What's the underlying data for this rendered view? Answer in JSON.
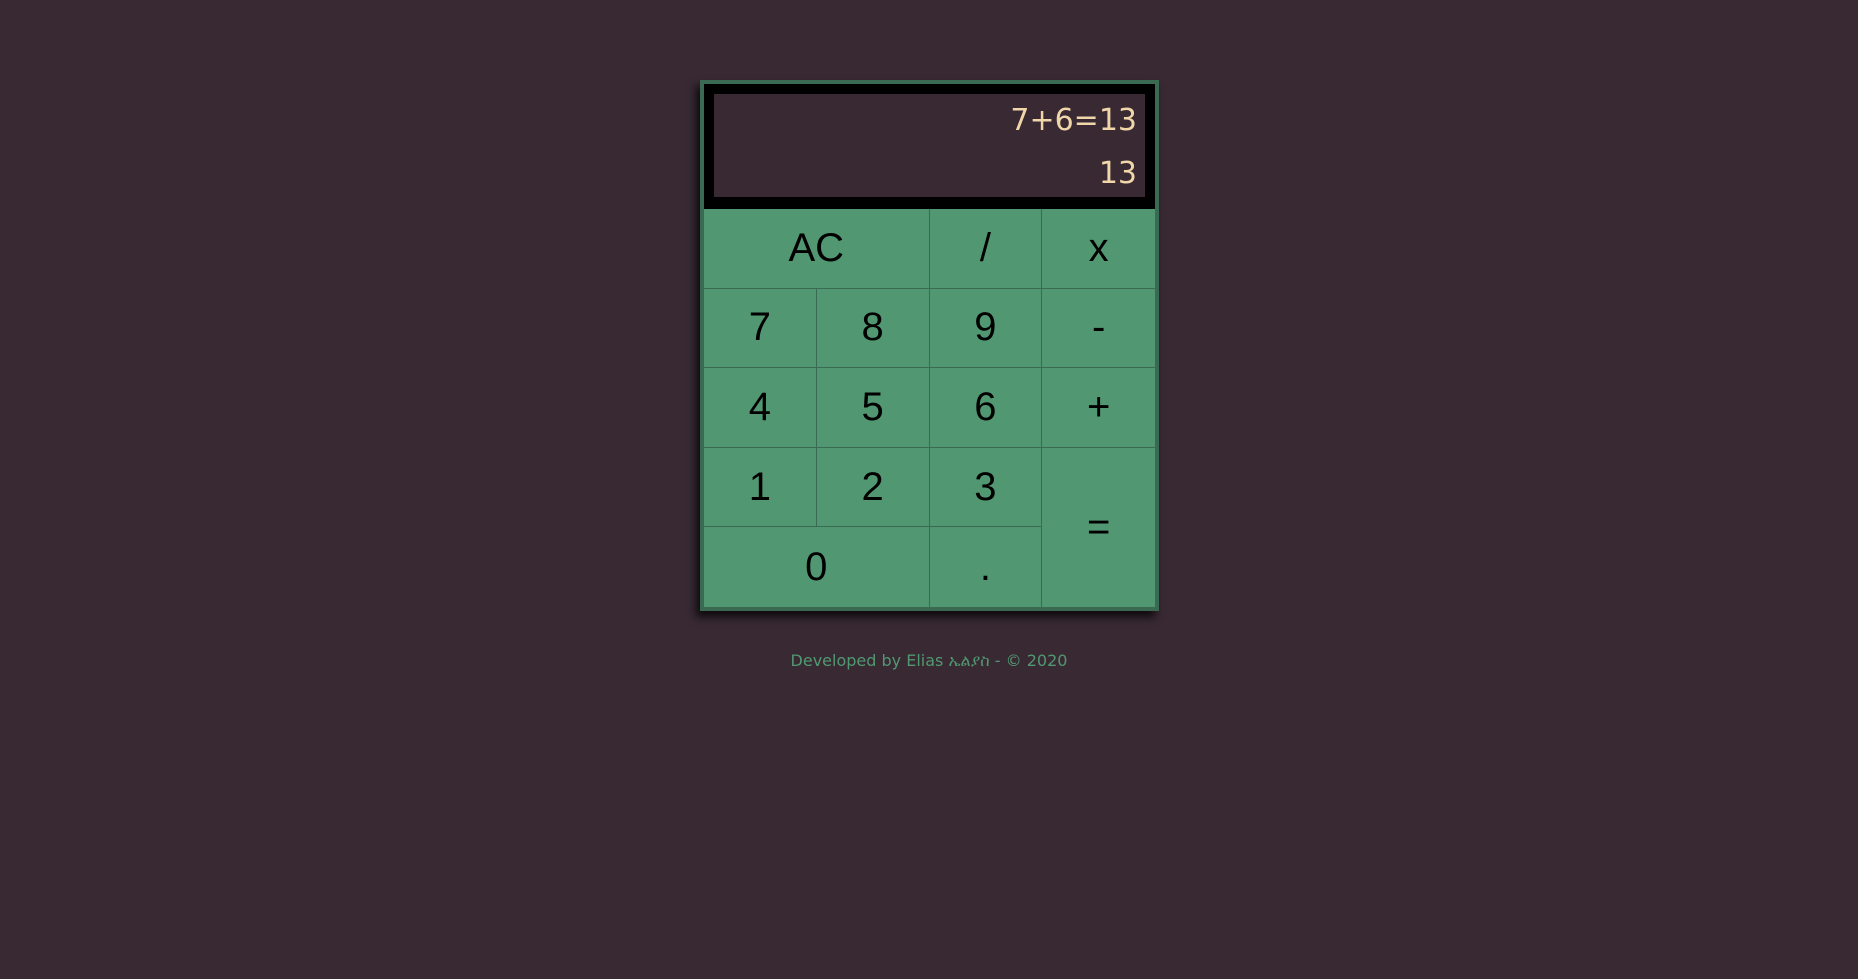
{
  "display": {
    "expression": "7+6=13",
    "result": "13"
  },
  "keys": {
    "ac": "AC",
    "divide": "/",
    "multiply": "x",
    "seven": "7",
    "eight": "8",
    "nine": "9",
    "minus": "-",
    "four": "4",
    "five": "5",
    "six": "6",
    "plus": "+",
    "one": "1",
    "two": "2",
    "three": "3",
    "equals": "=",
    "zero": "0",
    "decimal": "."
  },
  "footer": {
    "text": "Developed by Elias ኤልያስ - © 2020"
  },
  "colors": {
    "background": "#382933",
    "keypad": "#519872",
    "display_text": "#f0d6a8",
    "footer_text": "#519872"
  }
}
